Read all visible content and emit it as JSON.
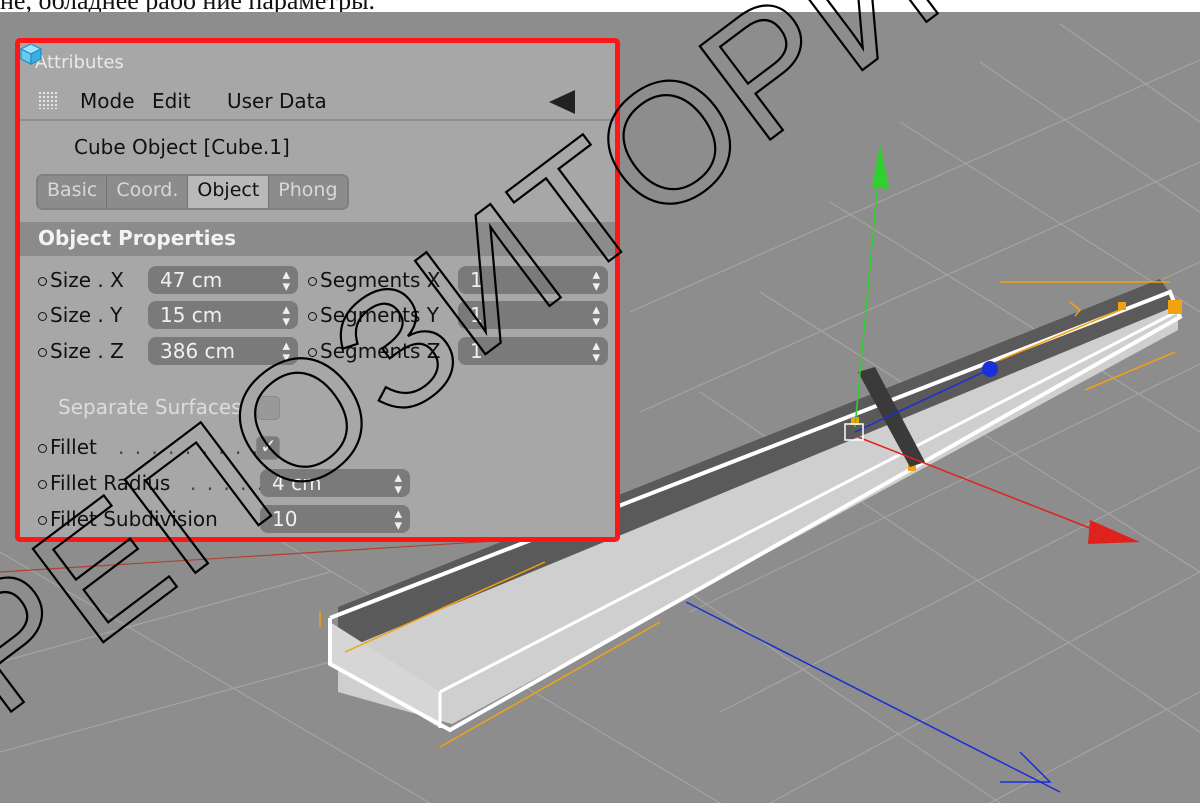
{
  "caption": "не, обладнее рабо ние параметры.",
  "panel": {
    "title": "Attributes",
    "menu": [
      "Mode",
      "Edit",
      "User Data"
    ],
    "object_title": "Cube Object [Cube.1]",
    "tabs": [
      {
        "label": "Basic",
        "active": false
      },
      {
        "label": "Coord.",
        "active": false
      },
      {
        "label": "Object",
        "active": true
      },
      {
        "label": "Phong",
        "active": false
      }
    ],
    "section": "Object Properties",
    "size_x": {
      "label": "Size . X",
      "value": "47 cm"
    },
    "size_y": {
      "label": "Size . Y",
      "value": "15 cm"
    },
    "size_z": {
      "label": "Size . Z",
      "value": "386 cm"
    },
    "seg_x": {
      "label": "Segments X",
      "value": "1"
    },
    "seg_y": {
      "label": "Segments Y",
      "value": "1"
    },
    "seg_z": {
      "label": "Segments Z",
      "value": "1"
    },
    "separate_surfaces": {
      "label": "Separate Surfaces",
      "checked": false
    },
    "fillet": {
      "label": "Fillet",
      "leader": ". . . . . . . . . .",
      "checked": true
    },
    "fillet_radius": {
      "label": "Fillet Radius",
      "leader": ". . . . . .",
      "value": "4 cm"
    },
    "fillet_subdivision": {
      "label": "Fillet Subdivision",
      "value": "10"
    }
  },
  "watermark": "РЕПОЗИТОРИЙ",
  "colors": {
    "panel_border": "#ff1616",
    "axis_y": "#2fd12f",
    "axis_x": "#e0221c",
    "axis_z": "#1b2fd6",
    "selection": "#f2a20f"
  }
}
